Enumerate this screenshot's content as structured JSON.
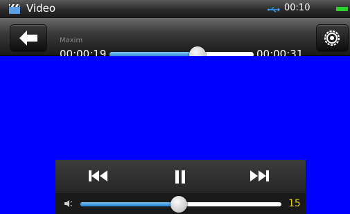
{
  "status_bar": {
    "app_title": "Video",
    "app_icon": "clapperboard-icon",
    "usb_icon": "usb-icon",
    "clock": "00:10",
    "battery_icon": "battery-icon",
    "battery_color": "#2cd12c"
  },
  "player": {
    "back_icon": "back-arrow-icon",
    "track_title": "Maxim",
    "elapsed": "00:00:19",
    "total": "00:00:31",
    "progress_fraction": 0.61,
    "settings_icon": "settings-icon"
  },
  "controls": {
    "previous_icon": "skip-previous-icon",
    "pause_icon": "pause-icon",
    "next_icon": "skip-next-icon",
    "volume_icon": "speaker-icon",
    "volume_fraction": 0.49,
    "volume_value": "15"
  },
  "colors": {
    "video_background": "#0000ff",
    "accent": "#1d7fd0",
    "volume_text": "#e6d21a"
  }
}
